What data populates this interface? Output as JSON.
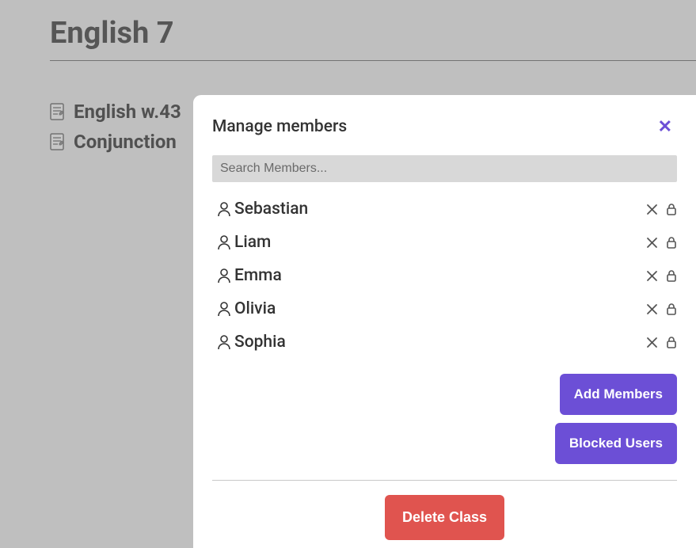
{
  "page": {
    "title": "English 7",
    "documents": [
      {
        "label": "English w.43"
      },
      {
        "label": "Conjunction"
      }
    ]
  },
  "modal": {
    "title": "Manage members",
    "search_placeholder": "Search Members...",
    "members": [
      {
        "name": "Sebastian"
      },
      {
        "name": "Liam"
      },
      {
        "name": "Emma"
      },
      {
        "name": "Olivia"
      },
      {
        "name": "Sophia"
      }
    ],
    "add_members_label": "Add Members",
    "blocked_users_label": "Blocked Users",
    "delete_class_label": "Delete Class"
  }
}
